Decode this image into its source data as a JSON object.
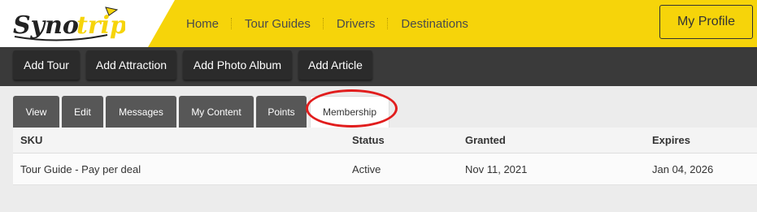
{
  "header": {
    "logo": {
      "text_dark": "Syno",
      "text_brand": "trip"
    },
    "nav": [
      {
        "label": "Home"
      },
      {
        "label": "Tour Guides"
      },
      {
        "label": "Drivers"
      },
      {
        "label": "Destinations"
      }
    ],
    "profile_label": "My Profile"
  },
  "actions": [
    {
      "label": "Add Tour"
    },
    {
      "label": "Add Attraction"
    },
    {
      "label": "Add Photo Album"
    },
    {
      "label": "Add Article"
    }
  ],
  "tabs": [
    {
      "label": "View"
    },
    {
      "label": "Edit"
    },
    {
      "label": "Messages"
    },
    {
      "label": "My Content"
    },
    {
      "label": "Points"
    },
    {
      "label": "Membership",
      "active": true
    }
  ],
  "table": {
    "headers": [
      "SKU",
      "Status",
      "Granted",
      "Expires"
    ],
    "rows": [
      [
        "Tour Guide - Pay per deal",
        "Active",
        "Nov 11, 2021",
        "Jan 04, 2026"
      ]
    ]
  },
  "colors": {
    "header_yellow": "#f6d40a",
    "action_bar": "#3a3a3a",
    "tab_dark": "#575757",
    "annotation_red": "#e11d1d"
  }
}
